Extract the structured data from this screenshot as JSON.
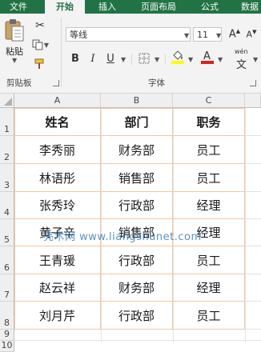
{
  "ribbon_tabs": [
    "文件",
    "开始",
    "插入",
    "页面布局",
    "公式",
    "数据"
  ],
  "active_tab": "开始",
  "clipboard": {
    "paste_label": "粘贴",
    "group_label": "剪贴板"
  },
  "font": {
    "name": "等线",
    "size": "11",
    "group_label": "字体",
    "wen_glyph": "wén"
  },
  "columns": [
    "A",
    "B",
    "C"
  ],
  "rows": [
    "1",
    "2",
    "3",
    "4",
    "5",
    "6",
    "7",
    "8",
    "9",
    "10"
  ],
  "table": {
    "headers": [
      "姓名",
      "部门",
      "职务"
    ],
    "records": [
      [
        "李秀丽",
        "财务部",
        "员工"
      ],
      [
        "林语彤",
        "销售部",
        "员工"
      ],
      [
        "张秀玲",
        "行政部",
        "经理"
      ],
      [
        "黄子辛",
        "销售部",
        "经理"
      ],
      [
        "王青瑗",
        "行政部",
        "员工"
      ],
      [
        "赵云祥",
        "财务部",
        "经理"
      ],
      [
        "刘月芹",
        "行政部",
        "员工"
      ]
    ]
  },
  "watermark": "亮术网 www.liangshunet.com",
  "colors": {
    "excel_green": "#217346",
    "cell_border": "#f4c7a4",
    "font_color_bar": "#e02020",
    "highlight_bar": "#ffff00"
  }
}
